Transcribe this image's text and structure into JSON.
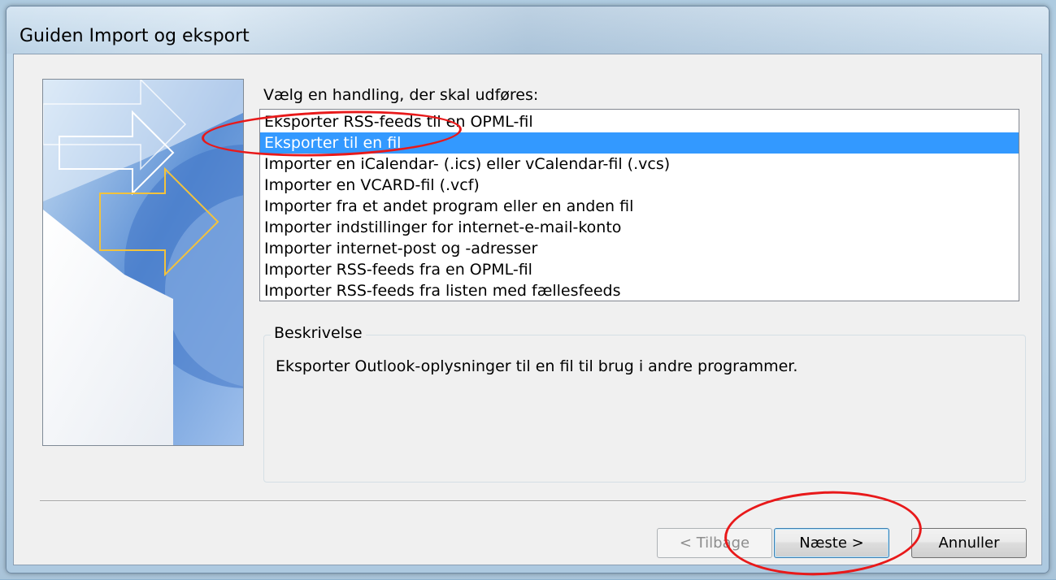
{
  "window": {
    "title": "Guiden Import og eksport"
  },
  "wizard": {
    "prompt": "Vælg en handling, der skal udføres:",
    "actions": [
      {
        "label": "Eksporter RSS-feeds til en OPML-fil",
        "selected": false
      },
      {
        "label": "Eksporter til en fil",
        "selected": true
      },
      {
        "label": "Importer en iCalendar- (.ics) eller vCalendar-fil (.vcs)",
        "selected": false
      },
      {
        "label": "Importer en VCARD-fil (.vcf)",
        "selected": false
      },
      {
        "label": "Importer fra et andet program eller en anden fil",
        "selected": false
      },
      {
        "label": "Importer indstillinger for internet-e-mail-konto",
        "selected": false
      },
      {
        "label": "Importer internet-post og -adresser",
        "selected": false
      },
      {
        "label": "Importer RSS-feeds fra en OPML-fil",
        "selected": false
      },
      {
        "label": "Importer RSS-feeds fra listen med fællesfeeds",
        "selected": false
      }
    ],
    "description": {
      "caption": "Beskrivelse",
      "text": "Eksporter Outlook-oplysninger til en fil til brug i andre programmer."
    }
  },
  "buttons": {
    "back": "< Tilbage",
    "next": "Næste >",
    "cancel": "Annuller"
  },
  "colors": {
    "selection": "#3399ff",
    "annotation": "#e8191a",
    "dialog_background": "#f0f0f0"
  },
  "icons": {
    "wizard_art": "import-export-arrows-art"
  }
}
